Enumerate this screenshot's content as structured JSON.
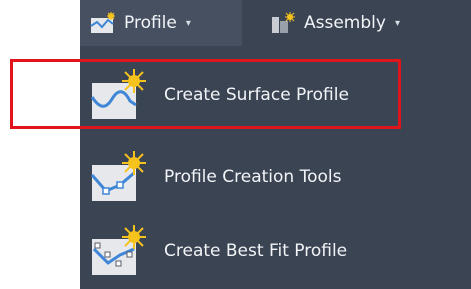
{
  "ribbon": {
    "tabs": [
      {
        "label": "Profile",
        "icon": "profile-icon",
        "caret": "▾"
      },
      {
        "label": "Assembly",
        "icon": "assembly-icon",
        "caret": "▾"
      }
    ]
  },
  "menu": {
    "items": [
      {
        "label": "Create Surface Profile",
        "icon": "surface-profile-icon"
      },
      {
        "label": "Profile Creation Tools",
        "icon": "profile-creation-tools-icon"
      },
      {
        "label": "Create Best Fit Profile",
        "icon": "best-fit-profile-icon"
      }
    ]
  },
  "colors": {
    "panel_bg": "#3b4453",
    "text": "#f2f4f7",
    "highlight_border": "#e0141b",
    "icon_blue": "#3f86d6",
    "icon_gold": "#f6c21c"
  }
}
